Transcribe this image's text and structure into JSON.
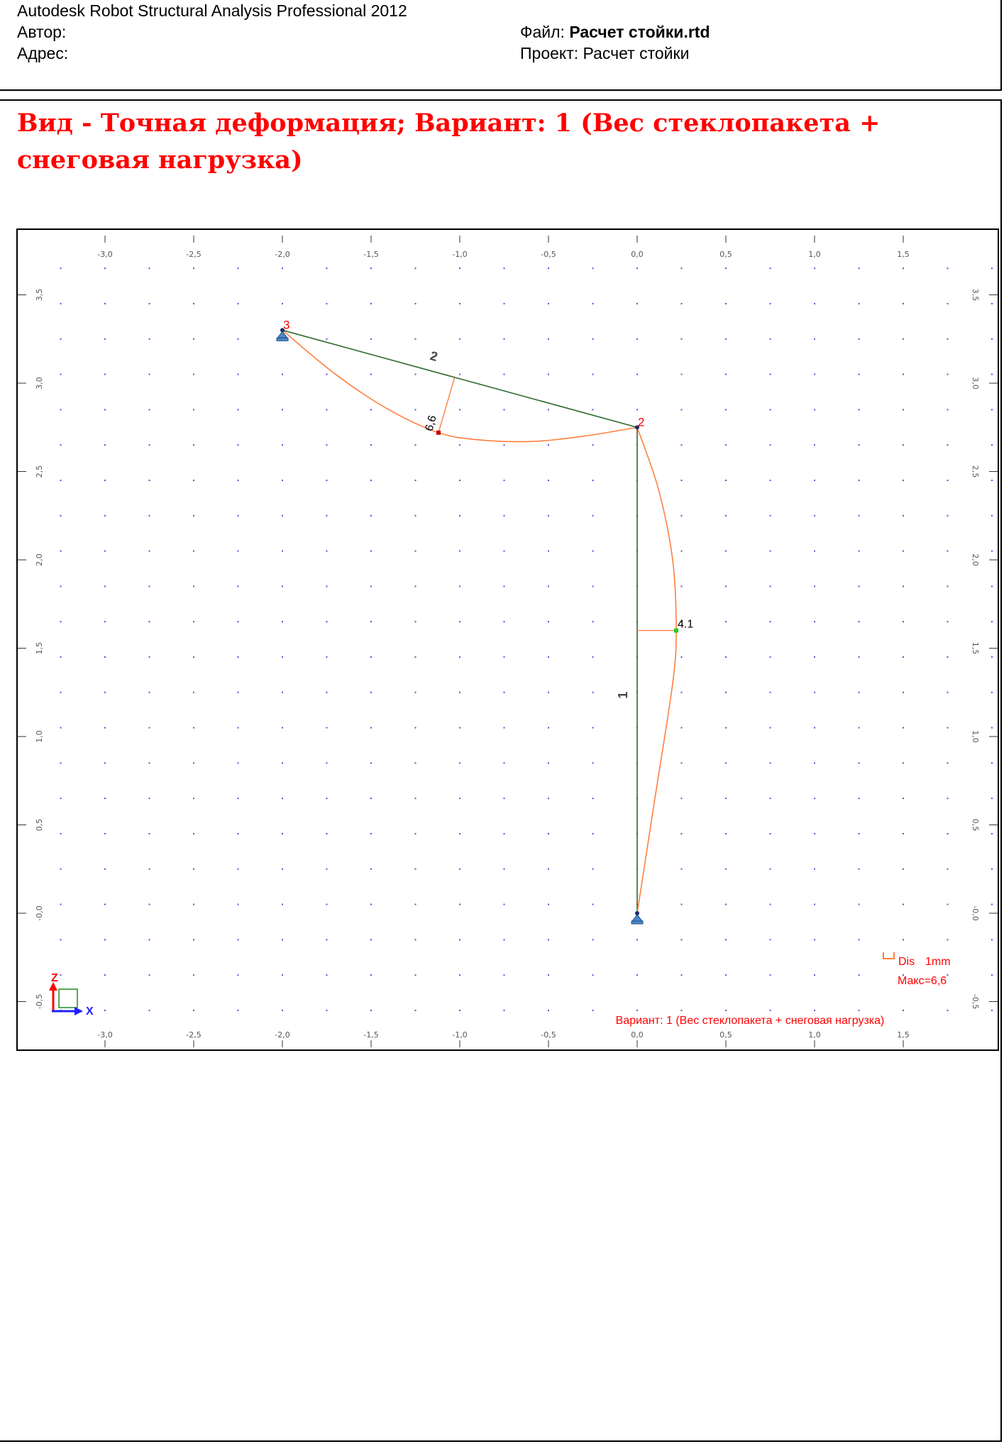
{
  "header": {
    "app_title": "Autodesk Robot Structural Analysis Professional 2012",
    "author_label": "Автор:",
    "address_label": "Адрес:",
    "file_label": "Файл:",
    "file_value": "Расчет стойки.rtd",
    "project_label": "Проект:",
    "project_value": "Расчет стойки"
  },
  "view_title": "Вид - Точная деформация; Вариант: 1 (Вес стеклопакета + снеговая нагрузка)",
  "chart_data": {
    "type": "structural-deformation-diagram",
    "x_ticks": [
      "-3,0",
      "-2,5",
      "-2,0",
      "-1,5",
      "-1,0",
      "-0,5",
      "0,0",
      "0,5",
      "1,0",
      "1,5"
    ],
    "x_tick_values": [
      -3.0,
      -2.5,
      -2.0,
      -1.5,
      -1.0,
      -0.5,
      0.0,
      0.5,
      1.0,
      1.5
    ],
    "y_ticks": [
      "-0,5",
      "-0,0",
      "0,5",
      "1,0",
      "1,5",
      "2,0",
      "2,5",
      "3,0",
      "3,5"
    ],
    "y_tick_values": [
      -0.5,
      0.0,
      0.5,
      1.0,
      1.5,
      2.0,
      2.5,
      3.0,
      3.5
    ],
    "xlim": [
      -3.5,
      2.0
    ],
    "ylim": [
      -0.75,
      3.85
    ],
    "grid": "dotted",
    "nodes": [
      {
        "id": "1",
        "x": 0.0,
        "y": 0.0,
        "label": "",
        "support": true
      },
      {
        "id": "2",
        "x": 0.0,
        "y": 2.75,
        "label": "2",
        "support": false
      },
      {
        "id": "3",
        "x": -2.0,
        "y": 3.3,
        "label": "3",
        "support": true
      }
    ],
    "bars": [
      {
        "label": "1",
        "from": "1",
        "to": "2"
      },
      {
        "label": "2",
        "from": "3",
        "to": "2"
      }
    ],
    "deformed_shapes": [
      {
        "bar": "1",
        "points": [
          [
            0.0,
            0.0
          ],
          [
            0.1,
            0.65
          ],
          [
            0.2,
            1.3
          ],
          [
            0.22,
            1.6
          ],
          [
            0.2,
            2.0
          ],
          [
            0.12,
            2.4
          ],
          [
            0.0,
            2.75
          ]
        ]
      },
      {
        "bar": "2",
        "points": [
          [
            -2.0,
            3.3
          ],
          [
            -1.7,
            3.05
          ],
          [
            -1.4,
            2.85
          ],
          [
            -1.12,
            2.72
          ],
          [
            -0.9,
            2.68
          ],
          [
            -0.6,
            2.67
          ],
          [
            -0.3,
            2.7
          ],
          [
            0.0,
            2.75
          ]
        ]
      }
    ],
    "max_markers": [
      {
        "label": "6,6",
        "x": -1.12,
        "y": 2.72,
        "ref_x": -1.03,
        "ref_y": 3.03,
        "color": "#cc0000"
      },
      {
        "label": "4.1",
        "x": 0.22,
        "y": 1.6,
        "ref_x": 0.0,
        "ref_y": 1.6,
        "color": "#22cc22"
      }
    ],
    "legend": {
      "dis_label": "Dis",
      "dis_unit": "1mm",
      "max_label": "Макс=6,6",
      "position": "bottom-right"
    },
    "case_caption": "Вариант: 1 (Вес стеклопакета + снеговая нагрузка)",
    "axis_x_label": "X",
    "axis_z_label": "Z",
    "colors": {
      "grid_dot": "#1a1acc",
      "member": "#2e6b2e",
      "deformation": "#ff7f3f",
      "label_red": "#ff0000",
      "support": "#4a8acb"
    }
  }
}
